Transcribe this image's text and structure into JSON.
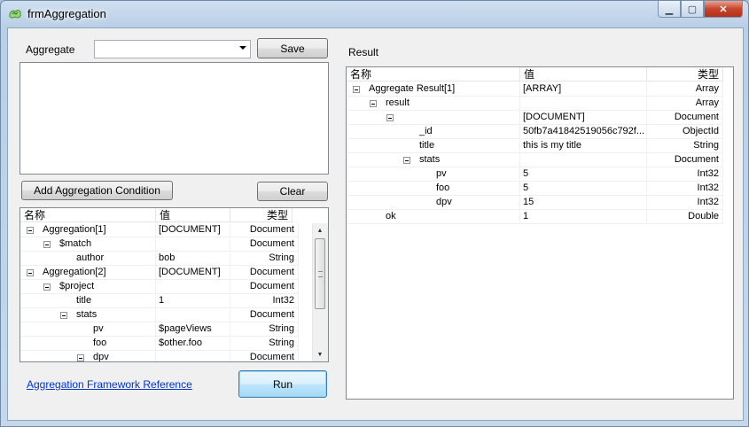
{
  "window": {
    "title": "frmAggregation",
    "controls": {
      "minimize": "▁",
      "maximize": "▢",
      "close": "✕"
    }
  },
  "left": {
    "aggregate_label": "Aggregate",
    "aggregate_value": "",
    "save_label": "Save",
    "add_condition_label": "Add Aggregation Condition",
    "clear_label": "Clear",
    "grid": {
      "columns": [
        "名称",
        "值",
        "类型"
      ],
      "rows": [
        {
          "name": "Aggregation[1]",
          "value": "[DOCUMENT]",
          "type": "Document",
          "level": 0,
          "expander": true
        },
        {
          "name": "$match",
          "value": "",
          "type": "Document",
          "level": 1,
          "expander": true
        },
        {
          "name": "author",
          "value": "bob",
          "type": "String",
          "level": 2,
          "expander": false
        },
        {
          "name": "Aggregation[2]",
          "value": "[DOCUMENT]",
          "type": "Document",
          "level": 0,
          "expander": true
        },
        {
          "name": "$project",
          "value": "",
          "type": "Document",
          "level": 1,
          "expander": true
        },
        {
          "name": "title",
          "value": "1",
          "type": "Int32",
          "level": 2,
          "expander": false
        },
        {
          "name": "stats",
          "value": "",
          "type": "Document",
          "level": 2,
          "expander": true
        },
        {
          "name": "pv",
          "value": "$pageViews",
          "type": "String",
          "level": 3,
          "expander": false
        },
        {
          "name": "foo",
          "value": "$other.foo",
          "type": "String",
          "level": 3,
          "expander": false
        },
        {
          "name": "dpv",
          "value": "",
          "type": "Document",
          "level": 3,
          "expander": true
        }
      ]
    },
    "reference_link": "Aggregation Framework Reference",
    "run_label": "Run"
  },
  "right": {
    "result_label": "Result",
    "grid": {
      "columns": [
        "名称",
        "值",
        "类型"
      ],
      "rows": [
        {
          "name": "Aggregate Result[1]",
          "value": "[ARRAY]",
          "type": "Array",
          "level": 0,
          "expander": true
        },
        {
          "name": "result",
          "value": "",
          "type": "Array",
          "level": 1,
          "expander": true
        },
        {
          "name": "",
          "value": "[DOCUMENT]",
          "type": "Document",
          "level": 2,
          "expander": true
        },
        {
          "name": "_id",
          "value": "50fb7a41842519056c792f...",
          "type": "ObjectId",
          "level": 3,
          "expander": false
        },
        {
          "name": "title",
          "value": "this is my title",
          "type": "String",
          "level": 3,
          "expander": false
        },
        {
          "name": "stats",
          "value": "",
          "type": "Document",
          "level": 3,
          "expander": true
        },
        {
          "name": "pv",
          "value": "5",
          "type": "Int32",
          "level": 4,
          "expander": false
        },
        {
          "name": "foo",
          "value": "5",
          "type": "Int32",
          "level": 4,
          "expander": false
        },
        {
          "name": "dpv",
          "value": "15",
          "type": "Int32",
          "level": 4,
          "expander": false
        },
        {
          "name": "ok",
          "value": "1",
          "type": "Double",
          "level": 1,
          "expander": false
        }
      ]
    }
  },
  "colors": {
    "link": "#0033cc",
    "window_frame": "#b9cfe6",
    "close_button": "#c7452c"
  }
}
